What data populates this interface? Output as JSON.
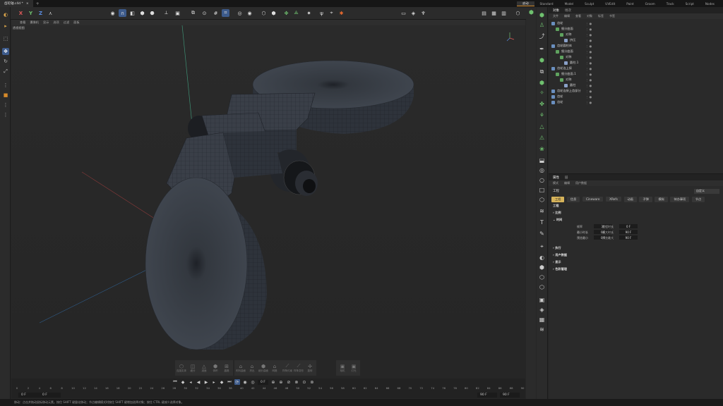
{
  "tabbar": {
    "doc_tab": "齿轮轴.c4d *",
    "layouts": [
      "启动",
      "Standard",
      "Model",
      "Sculpt",
      "UVEdit",
      "Paint",
      "Groom",
      "Track",
      "Script",
      "Nodes"
    ]
  },
  "toolbar": {
    "axis_x": "X",
    "axis_y": "Y",
    "axis_z": "Z"
  },
  "viewport": {
    "menu": [
      "查看",
      "摄像机",
      "显示",
      "选项",
      "过滤",
      "面板"
    ],
    "label": "透视视图"
  },
  "bottom_tools": {
    "group1": [
      "连接实体",
      "细分",
      "减面",
      "体积",
      "晶格"
    ],
    "group2": [
      "布料曲面",
      "挤出",
      "细分曲面",
      "网格"
    ],
    "group3": [
      "样条约束",
      "样条变形",
      "旋转"
    ],
    "group4": [
      "相机",
      "灯光"
    ]
  },
  "timeline": {
    "current_frame": "0 F",
    "start": "0 F",
    "start2": "0 F",
    "end": "90 F",
    "end2": "90 F",
    "ticks": [
      "0",
      "2",
      "4",
      "6",
      "8",
      "10",
      "12",
      "14",
      "16",
      "18",
      "20",
      "22",
      "24",
      "26",
      "28",
      "30",
      "32",
      "34",
      "36",
      "38",
      "40",
      "42",
      "44",
      "46",
      "48",
      "50",
      "52",
      "54",
      "56",
      "58",
      "60",
      "62",
      "64",
      "66",
      "68",
      "70",
      "72",
      "74",
      "76",
      "78",
      "80",
      "82",
      "84",
      "86",
      "88",
      "90"
    ]
  },
  "status": "移动：点击并拖动鼠标移动元素。按住 SHIFT 键量化移动；节点编辑模式时按住 SHIFT 键增加选择对象；按住 CTRL 键减少选择对象。",
  "objects_panel": {
    "tabs": [
      "对象",
      "场次"
    ],
    "menu": [
      "文件",
      "编辑",
      "查看",
      "对象",
      "标签",
      "书签"
    ],
    "rows": [
      {
        "name": "齿轮",
        "indent": 0,
        "color": "#6a8fbf"
      },
      {
        "name": "细分曲面",
        "indent": 1,
        "color": "#5fa35f"
      },
      {
        "name": "对称",
        "indent": 2,
        "color": "#5fa35f"
      },
      {
        "name": "挤压",
        "indent": 3,
        "color": "#8aa0c8"
      },
      {
        "name": "齿轮圆柱体",
        "indent": 0,
        "color": "#6a8fbf"
      },
      {
        "name": "细分曲面",
        "indent": 1,
        "color": "#5fa35f"
      },
      {
        "name": "对称",
        "indent": 2,
        "color": "#5fa35f"
      },
      {
        "name": "圆柱.1",
        "indent": 3,
        "color": "#8aa0c8"
      },
      {
        "name": "齿轮连上接",
        "indent": 0,
        "color": "#6a8fbf"
      },
      {
        "name": "细分曲面.1",
        "indent": 1,
        "color": "#5fa35f"
      },
      {
        "name": "对称",
        "indent": 2,
        "color": "#5fa35f"
      },
      {
        "name": "圆柱",
        "indent": 3,
        "color": "#8aa0c8"
      },
      {
        "name": "齿轮连接上齿部分",
        "indent": 0,
        "color": "#6a8fbf"
      },
      {
        "name": "齿轮",
        "indent": 0,
        "color": "#6a8fbf"
      },
      {
        "name": "齿轮",
        "indent": 0,
        "color": "#6a8fbf"
      }
    ]
  },
  "attributes_panel": {
    "tabs": [
      "属性",
      "层"
    ],
    "menu": [
      "模式",
      "编辑",
      "用户数据"
    ],
    "title": "工程",
    "preset": "自定义",
    "subtabs": [
      "工程",
      "信息",
      "Cineware",
      "XRefs",
      "动画",
      "子弹",
      "模拟",
      "待办事项",
      "节点"
    ],
    "section": "工程",
    "groups": [
      "比例",
      "时间",
      "执行",
      "用户数据",
      "显示",
      "色彩管理"
    ],
    "fields": {
      "fps_label": "帧率",
      "fps": "30",
      "project_time_label": "工程时长",
      "project_time": "0 F",
      "min_time_label": "最小时长",
      "min_time": "0 F",
      "max_time_label": "最大时长",
      "max_time": "90 F",
      "preview_min_label": "预览最小",
      "preview_min": "0 F",
      "preview_max_label": "预览最大",
      "preview_max": "90 F"
    }
  }
}
